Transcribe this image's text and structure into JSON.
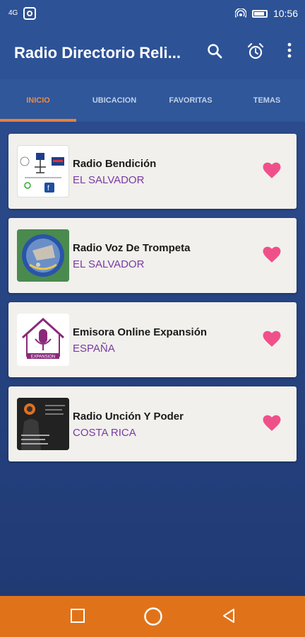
{
  "status": {
    "time": "10:56",
    "signal_text": "4G"
  },
  "app": {
    "title": "Radio Directorio Reli..."
  },
  "tabs": [
    "INICIO",
    "UBICACION",
    "FAVORITAS",
    "TEMAS"
  ],
  "stations": [
    {
      "name": "Radio Bendición",
      "country": "EL SALVADOR"
    },
    {
      "name": "Radio Voz De Trompeta",
      "country": "EL SALVADOR"
    },
    {
      "name": "Emisora Online Expansión",
      "country": "ESPAÑA"
    },
    {
      "name": "Radio Unción Y Poder",
      "country": "COSTA RICA"
    }
  ],
  "logo3_text": "EXPANSION",
  "colors": {
    "primary": "#2d5296",
    "accent": "#e8803a",
    "heart": "#f0508a",
    "country": "#7a3aa5"
  }
}
